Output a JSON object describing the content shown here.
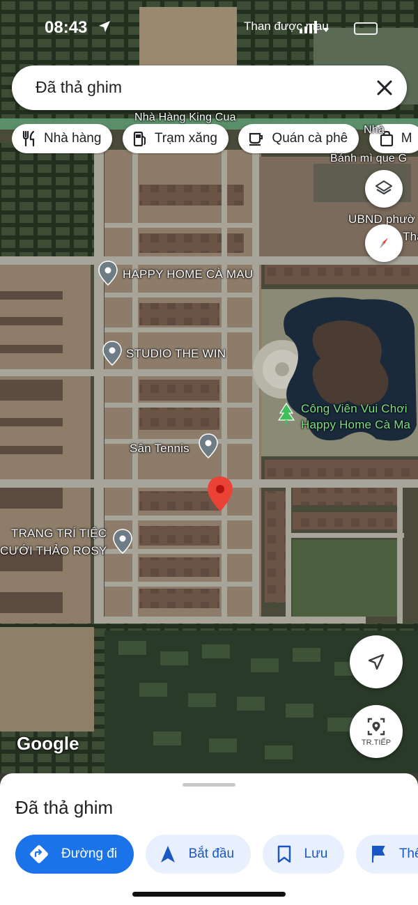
{
  "status_bar": {
    "time": "08:43",
    "carrier": "Than được mau"
  },
  "search": {
    "value": "Đã thả ghim"
  },
  "chips": [
    {
      "label": "Nhà hàng",
      "icon": "fork-knife-icon"
    },
    {
      "label": "Trạm xăng",
      "icon": "gas-pump-icon"
    },
    {
      "label": "Quán cà phê",
      "icon": "coffee-cup-icon"
    },
    {
      "label": "M",
      "icon": "shopping-bag-icon"
    }
  ],
  "map": {
    "labels": {
      "nha_hang": "Nhà Hàng King Cua",
      "nha": "Nhà",
      "banh_mi": "Bánh mì que G",
      "ubnd": "UBND phườ",
      "tha": "Thà",
      "happy_home": "HAPPY HOME CÀ MAU",
      "studio": "STUDIO THE WIN",
      "cong_vien_1": "Công Viên Vui Chơi",
      "cong_vien_2": "Happy Home Cà Ma",
      "san_tennis": "Sân Tennis",
      "trang_tri_1": "TRANG TRÍ TIỆC",
      "trang_tri_2": "CƯỚI THẢO ROSY"
    },
    "attribution": "Google",
    "live_view_label": "TR.TIẾP"
  },
  "sheet": {
    "title": "Đã thả ghim",
    "actions": [
      {
        "label": "Đường đi",
        "icon": "directions-icon",
        "primary": true
      },
      {
        "label": "Bắt đầu",
        "icon": "navigation-arrow-icon"
      },
      {
        "label": "Lưu",
        "icon": "bookmark-icon"
      },
      {
        "label": "Thê",
        "icon": "flag-icon"
      }
    ]
  },
  "colors": {
    "accent": "#1a73e8",
    "pin": "#ea4335",
    "park_label": "#7ee08a"
  }
}
